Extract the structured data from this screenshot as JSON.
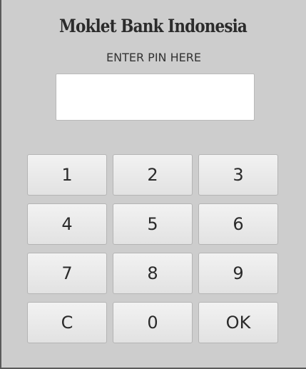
{
  "header": {
    "title": "Moklet Bank Indonesia",
    "pin_label": "ENTER PIN HERE"
  },
  "pin_field": {
    "value": "",
    "placeholder": ""
  },
  "keypad": {
    "keys": [
      "1",
      "2",
      "3",
      "4",
      "5",
      "6",
      "7",
      "8",
      "9",
      "C",
      "0",
      "OK"
    ]
  },
  "colors": {
    "background": "#cdcdcd",
    "button_face": "#ececec",
    "text": "#2a2a2a"
  }
}
